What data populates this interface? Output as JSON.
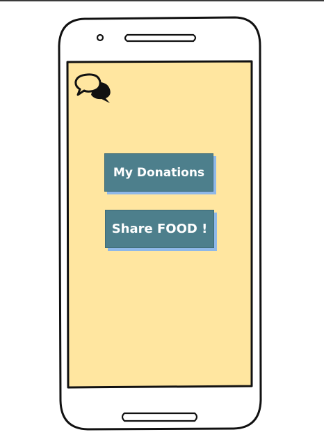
{
  "screen": {
    "background_color": "#ffe6a0",
    "bezel_color": "#ffffff",
    "outline_color": "#111111"
  },
  "top_bar": {
    "chat_icon": "chat-bubbles-icon"
  },
  "actions": {
    "my_donations_label": "My Donations",
    "share_food_label": "Share FOOD !",
    "button_color": "#4d7f8c",
    "button_shadow_color": "#8fb8e8"
  }
}
